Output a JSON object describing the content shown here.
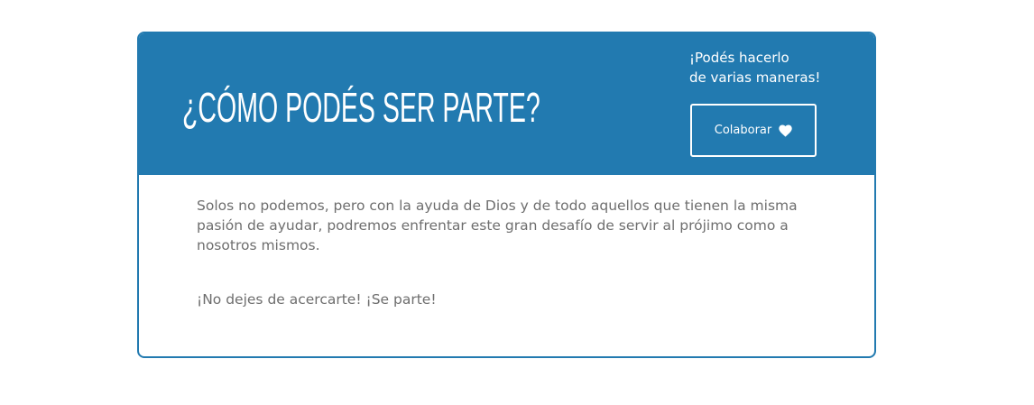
{
  "header": {
    "title": "¿CÓMO PODÉS SER PARTE?",
    "side_line_1": "¡Podés hacerlo",
    "side_line_2": "de varias maneras!",
    "button_label": "Colaborar",
    "button_icon": "heart-icon"
  },
  "body": {
    "paragraph_1": "Solos no podemos, pero con la ayuda de Dios y de todo aquellos que tienen la misma pasión de ayudar, podremos enfrentar este gran desafío de servir al prójimo como a nosotros mismos.",
    "paragraph_2": "¡No dejes de acercarte! ¡Se parte!"
  },
  "colors": {
    "accent": "#227ab0",
    "body_text": "#6e6e6e",
    "background": "#ffffff"
  }
}
